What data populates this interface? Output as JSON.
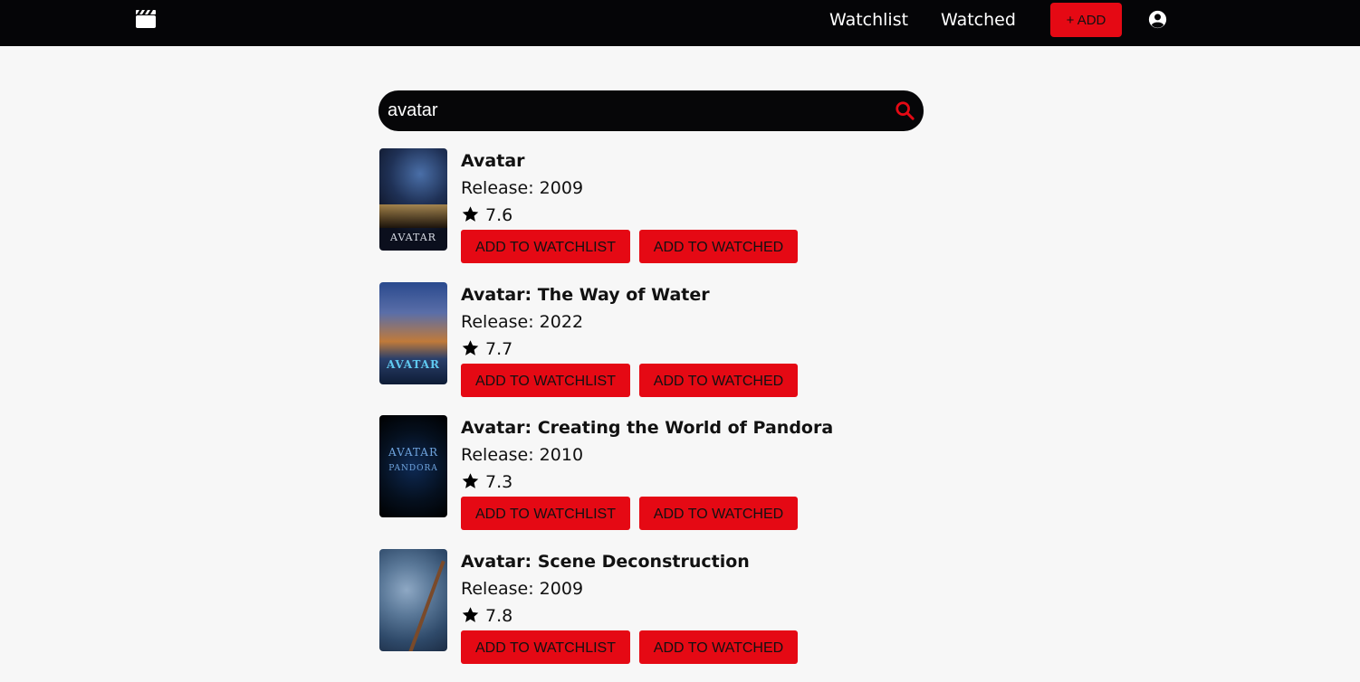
{
  "nav": {
    "logo_icon": "clapperboard-icon",
    "links": [
      "Watchlist",
      "Watched"
    ],
    "add_label": "+ ADD",
    "user_icon": "user-circle-icon"
  },
  "search": {
    "value": "avatar",
    "icon": "search-icon"
  },
  "colors": {
    "navbar": "#050507",
    "accent": "#e50914",
    "background": "#f7f7f7"
  },
  "results": [
    {
      "title": "Avatar",
      "release": "Release: 2009",
      "rating": "7.6",
      "poster_text": "AVATAR",
      "watchlist_label": "ADD TO WATCHLIST",
      "watched_label": "ADD TO WATCHED"
    },
    {
      "title": "Avatar: The Way of Water",
      "release": "Release: 2022",
      "rating": "7.7",
      "poster_text": "AVATAR",
      "watchlist_label": "ADD TO WATCHLIST",
      "watched_label": "ADD TO WATCHED"
    },
    {
      "title": "Avatar: Creating the World of Pandora",
      "release": "Release: 2010",
      "rating": "7.3",
      "poster_text": "AVATAR",
      "poster_text2": "PANDORA",
      "watchlist_label": "ADD TO WATCHLIST",
      "watched_label": "ADD TO WATCHED"
    },
    {
      "title": "Avatar: Scene Deconstruction",
      "release": "Release: 2009",
      "rating": "7.8",
      "watchlist_label": "ADD TO WATCHLIST",
      "watched_label": "ADD TO WATCHED"
    }
  ]
}
